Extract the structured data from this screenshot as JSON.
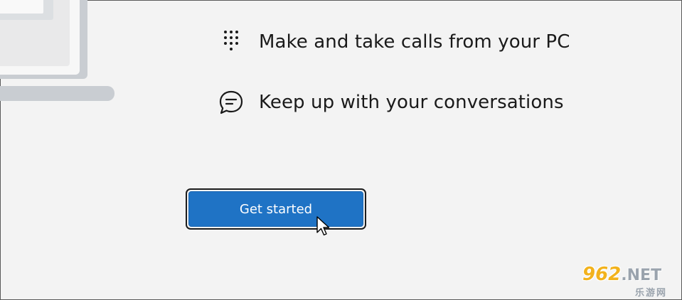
{
  "features": [
    {
      "icon": "dialpad-icon",
      "label": "Make and take calls from your PC"
    },
    {
      "icon": "chat-bubble-icon",
      "label": "Keep up with your conversations"
    }
  ],
  "actions": {
    "get_started_label": "Get started"
  },
  "illustration": {
    "icon": "laptop-illustration"
  },
  "watermark": {
    "number": "962",
    "suffix": ".NET",
    "subtitle": "乐游网"
  },
  "colors": {
    "background": "#f3f3f3",
    "accent": "#1f73c5",
    "text": "#1a1a1a",
    "watermark_gold": "#f2b21c"
  }
}
